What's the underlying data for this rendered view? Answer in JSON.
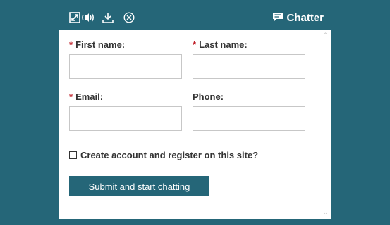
{
  "header": {
    "icons": [
      "expand-icon",
      "volume-icon",
      "download-icon",
      "close-circle-icon"
    ],
    "title": "Chatter",
    "title_icon": "chat-bubble-icon"
  },
  "form": {
    "first_name": {
      "label": "First name:",
      "required_mark": "*",
      "value": ""
    },
    "last_name": {
      "label": "Last name:",
      "required_mark": "*",
      "value": ""
    },
    "email": {
      "label": "Email:",
      "required_mark": "*",
      "value": ""
    },
    "phone": {
      "label": "Phone:",
      "value": ""
    },
    "create_account": {
      "label": "Create account and register on this site?",
      "checked": false
    },
    "submit_label": "Submit and start chatting"
  },
  "colors": {
    "page_background": "#256678",
    "header_background": "#256678",
    "button_background": "#256678",
    "required_mark": "#c0202a"
  }
}
